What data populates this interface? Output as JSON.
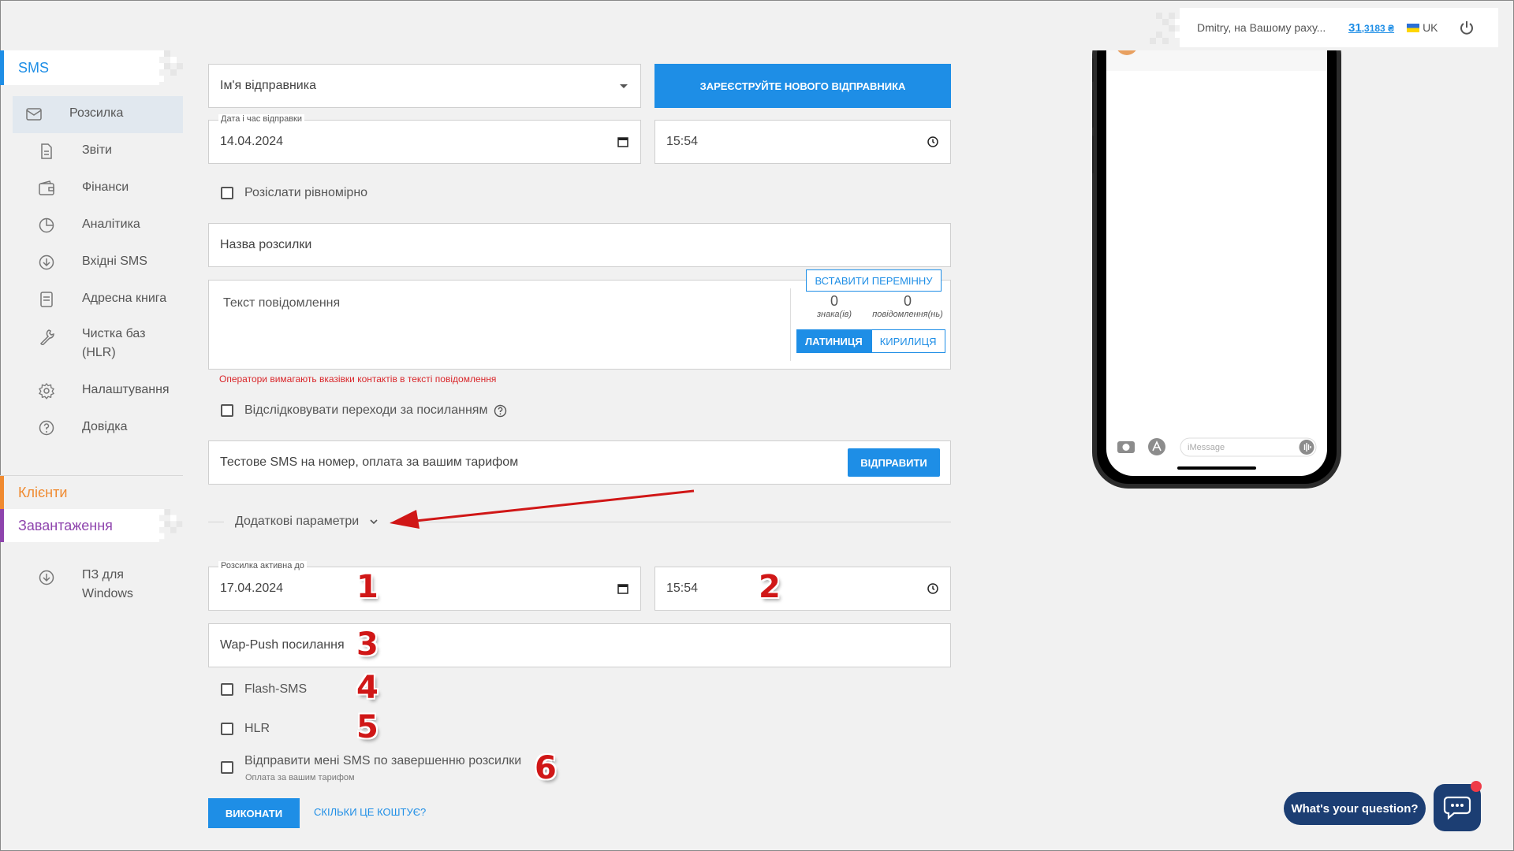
{
  "header": {
    "greeting": "Dmitry, на Вашому раху...",
    "balance_main": "31",
    "balance_fraction": ",3183 ₴",
    "lang": "UK"
  },
  "sidebar": {
    "sms_section": "SMS",
    "items": [
      {
        "label": "Розсилка",
        "icon": "mail-icon"
      },
      {
        "label": "Звіти",
        "icon": "report-icon"
      },
      {
        "label": "Фінанси",
        "icon": "wallet-icon"
      },
      {
        "label": "Аналітика",
        "icon": "pie-chart-icon"
      },
      {
        "label": "Вхідні SMS",
        "icon": "inbox-download-icon"
      },
      {
        "label": "Адресна книга",
        "icon": "address-book-icon"
      },
      {
        "label": "Чистка баз (HLR)",
        "line1": "Чистка баз",
        "line2": "(HLR)",
        "icon": "wrench-icon"
      },
      {
        "label": "Налаштування",
        "icon": "gear-icon"
      },
      {
        "label": "Довідка",
        "icon": "help-circle-icon"
      }
    ],
    "clients_section": "Клієнти",
    "loads_section": "Завантаження",
    "download_item": {
      "line1": "ПЗ для",
      "line2": "Windows",
      "icon": "download-icon"
    }
  },
  "form": {
    "sender_placeholder": "Ім'я відправника",
    "register_sender": "ЗАРЕЄСТРУЙТЕ НОВОГО ВІДПРАВНИКА",
    "send_date_label": "Дата і час відправки",
    "send_date": "14.04.2024",
    "send_time": "15:54",
    "distribute_evenly": "Розіслати рівномірно",
    "campaign_name_placeholder": "Назва розсилки",
    "message_placeholder": "Текст повідомлення",
    "insert_variable": "ВСТАВИТИ ПЕРЕМІННУ",
    "chars_count": "0",
    "chars_label": "знака(ів)",
    "messages_count": "0",
    "messages_label": "повідомлення(нь)",
    "latin": "ЛАТИНИЦЯ",
    "cyrillic": "КИРИЛИЦЯ",
    "warning": "Оператори вимагають вказівки контактів в тексті повідомлення",
    "track_links": "Відслідковувати переходи за посиланням",
    "test_sms_placeholder": "Тестове SMS на номер, оплата за вашим тарифом",
    "send_button": "ВІДПРАВИТИ",
    "additional_params": "Додаткові параметри",
    "active_until_label": "Розсилка активна до",
    "active_until_date": "17.04.2024",
    "active_until_time": "15:54",
    "wap_push_placeholder": "Wap-Push посилання",
    "flash_sms": "Flash-SMS",
    "hlr": "HLR",
    "notify_me": "Відправити мені SMS по завершенню розсилки",
    "notify_note": "Оплата за вашим тарифом",
    "execute": "ВИКОНАТИ",
    "how_much": "СКІЛЬКИ ЦЕ КОШТУЄ?"
  },
  "annotations": [
    "1",
    "2",
    "3",
    "4",
    "5",
    "6"
  ],
  "phone": {
    "imessage_placeholder": "iMessage"
  },
  "chat": {
    "question": "What's your question?"
  },
  "colors": {
    "accent": "#1e8ee6",
    "clients": "#f08a30",
    "loads": "#8e44ad",
    "warning": "#d9262a",
    "annotation": "#d01717",
    "chat": "#1c3e73"
  }
}
